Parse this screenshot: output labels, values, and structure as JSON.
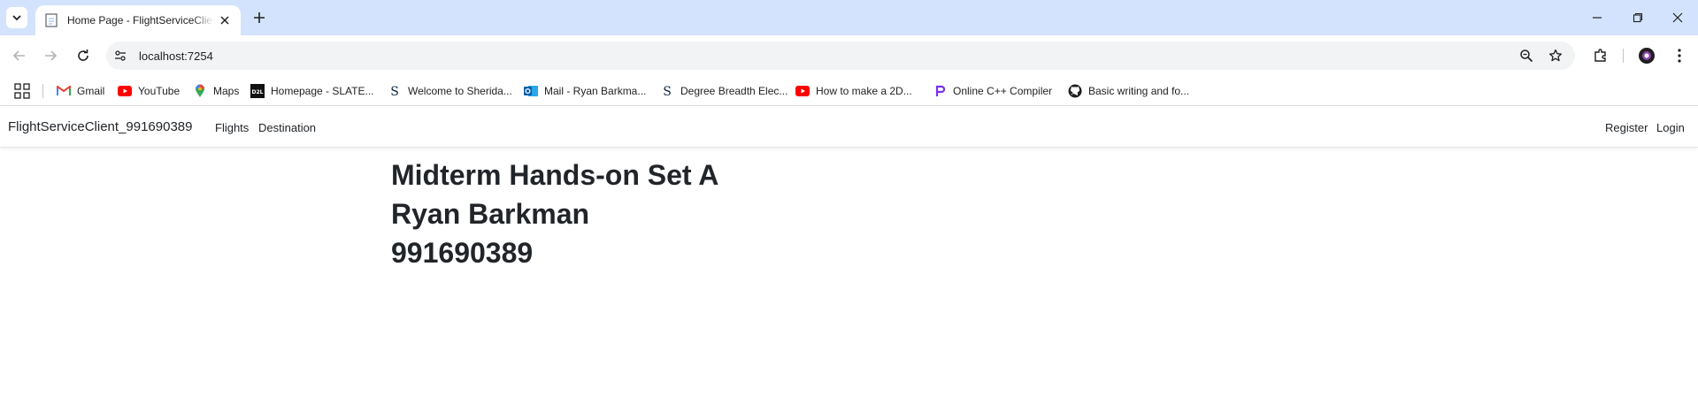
{
  "browser": {
    "tab": {
      "title": "Home Page - FlightServiceClient_991690389",
      "favicon": "document-icon"
    },
    "url": "localhost:7254",
    "bookmarks": [
      {
        "label": "Gmail",
        "icon": "gmail-icon"
      },
      {
        "label": "YouTube",
        "icon": "youtube-icon"
      },
      {
        "label": "Maps",
        "icon": "maps-icon"
      },
      {
        "label": "Homepage - SLATE...",
        "icon": "d2l-icon"
      },
      {
        "label": "Welcome to Sherida...",
        "icon": "sheridan-icon"
      },
      {
        "label": "Mail - Ryan Barkma...",
        "icon": "outlook-icon"
      },
      {
        "label": "Degree Breadth Elec...",
        "icon": "sheridan-icon"
      },
      {
        "label": "How to make a 2D...",
        "icon": "youtube-icon"
      },
      {
        "label": "Online C++ Compiler",
        "icon": "compiler-icon"
      },
      {
        "label": "Basic writing and fo...",
        "icon": "github-icon"
      }
    ]
  },
  "site": {
    "brand": "FlightServiceClient_991690389",
    "nav": [
      "Flights",
      "Destination"
    ],
    "nav_right": [
      "Register",
      "Login"
    ]
  },
  "main": {
    "lines": [
      "Midterm Hands-on Set A",
      "Ryan Barkman",
      "991690389"
    ]
  },
  "colors": {
    "tabstrip": "#d3e3fd",
    "omnibox": "#f1f3f4",
    "text": "#212529"
  }
}
